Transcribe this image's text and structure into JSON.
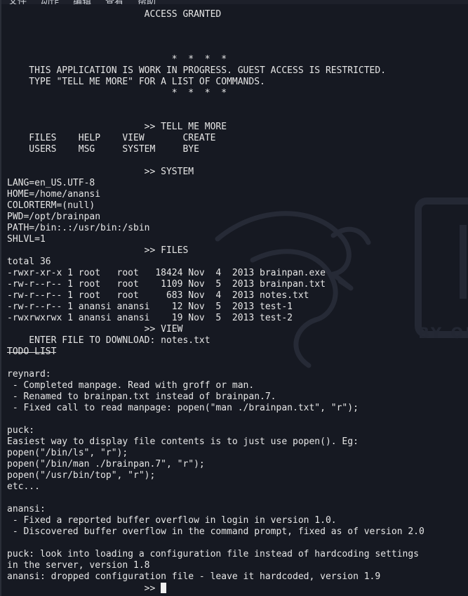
{
  "menubar": {
    "items": [
      "文件",
      "动作",
      "编辑",
      "查看",
      "帮助"
    ]
  },
  "background": {
    "logo_text": "BY OF"
  },
  "terminal": {
    "lines": [
      "                         ACCESS GRANTED",
      "",
      "",
      "",
      "                              *  *  *  *",
      "    THIS APPLICATION IS WORK IN PROGRESS. GUEST ACCESS IS RESTRICTED.",
      "    TYPE \"TELL ME MORE\" FOR A LIST OF COMMANDS.",
      "                              *  *  *  *",
      "",
      "",
      "                         >> TELL ME MORE",
      "    FILES    HELP    VIEW       CREATE",
      "    USERS    MSG     SYSTEM     BYE",
      "",
      "                         >> SYSTEM",
      "LANG=en_US.UTF-8",
      "HOME=/home/anansi",
      "COLORTERM=(null)",
      "PWD=/opt/brainpan",
      "PATH=/bin:.:/usr/bin:/sbin",
      "SHLVL=1",
      "                         >> FILES",
      "total 36",
      "-rwxr-xr-x 1 root   root   18424 Nov  4  2013 brainpan.exe",
      "-rw-r--r-- 1 root   root    1109 Nov  5  2013 brainpan.txt",
      "-rw-r--r-- 1 root   root     683 Nov  4  2013 notes.txt",
      "-rw-r--r-- 1 anansi anansi    12 Nov  5  2013 test-1",
      "-rwxrwxrwx 1 anansi anansi    19 Nov  5  2013 test-2",
      "                         >> VIEW",
      "    ENTER FILE TO DOWNLOAD: notes.txt",
      "TODO LIST",
      "",
      "reynard:",
      " - Completed manpage. Read with groff or man.",
      " - Renamed to brainpan.txt instead of brainpan.7.",
      " - Fixed call to read manpage: popen(\"man ./brainpan.txt\", \"r\");",
      "",
      "puck:",
      "Easiest way to display file contents is to just use popen(). Eg:",
      "popen(\"/bin/ls\", \"r\");",
      "popen(\"/bin/man ./brainpan.7\", \"r\");",
      "popen(\"/usr/bin/top\", \"r\");",
      "etc...",
      "",
      "anansi:",
      " - Fixed a reported buffer overflow in login in version 1.0.",
      " - Discovered buffer overflow in the command prompt, fixed as of version 2.0",
      "",
      "puck: look into loading a configuration file instead of hardcoding settings",
      "in the server, version 1.8",
      "anansi: dropped configuration file - leave it hardcoded, version 1.9"
    ],
    "prompt": "                         >> "
  }
}
